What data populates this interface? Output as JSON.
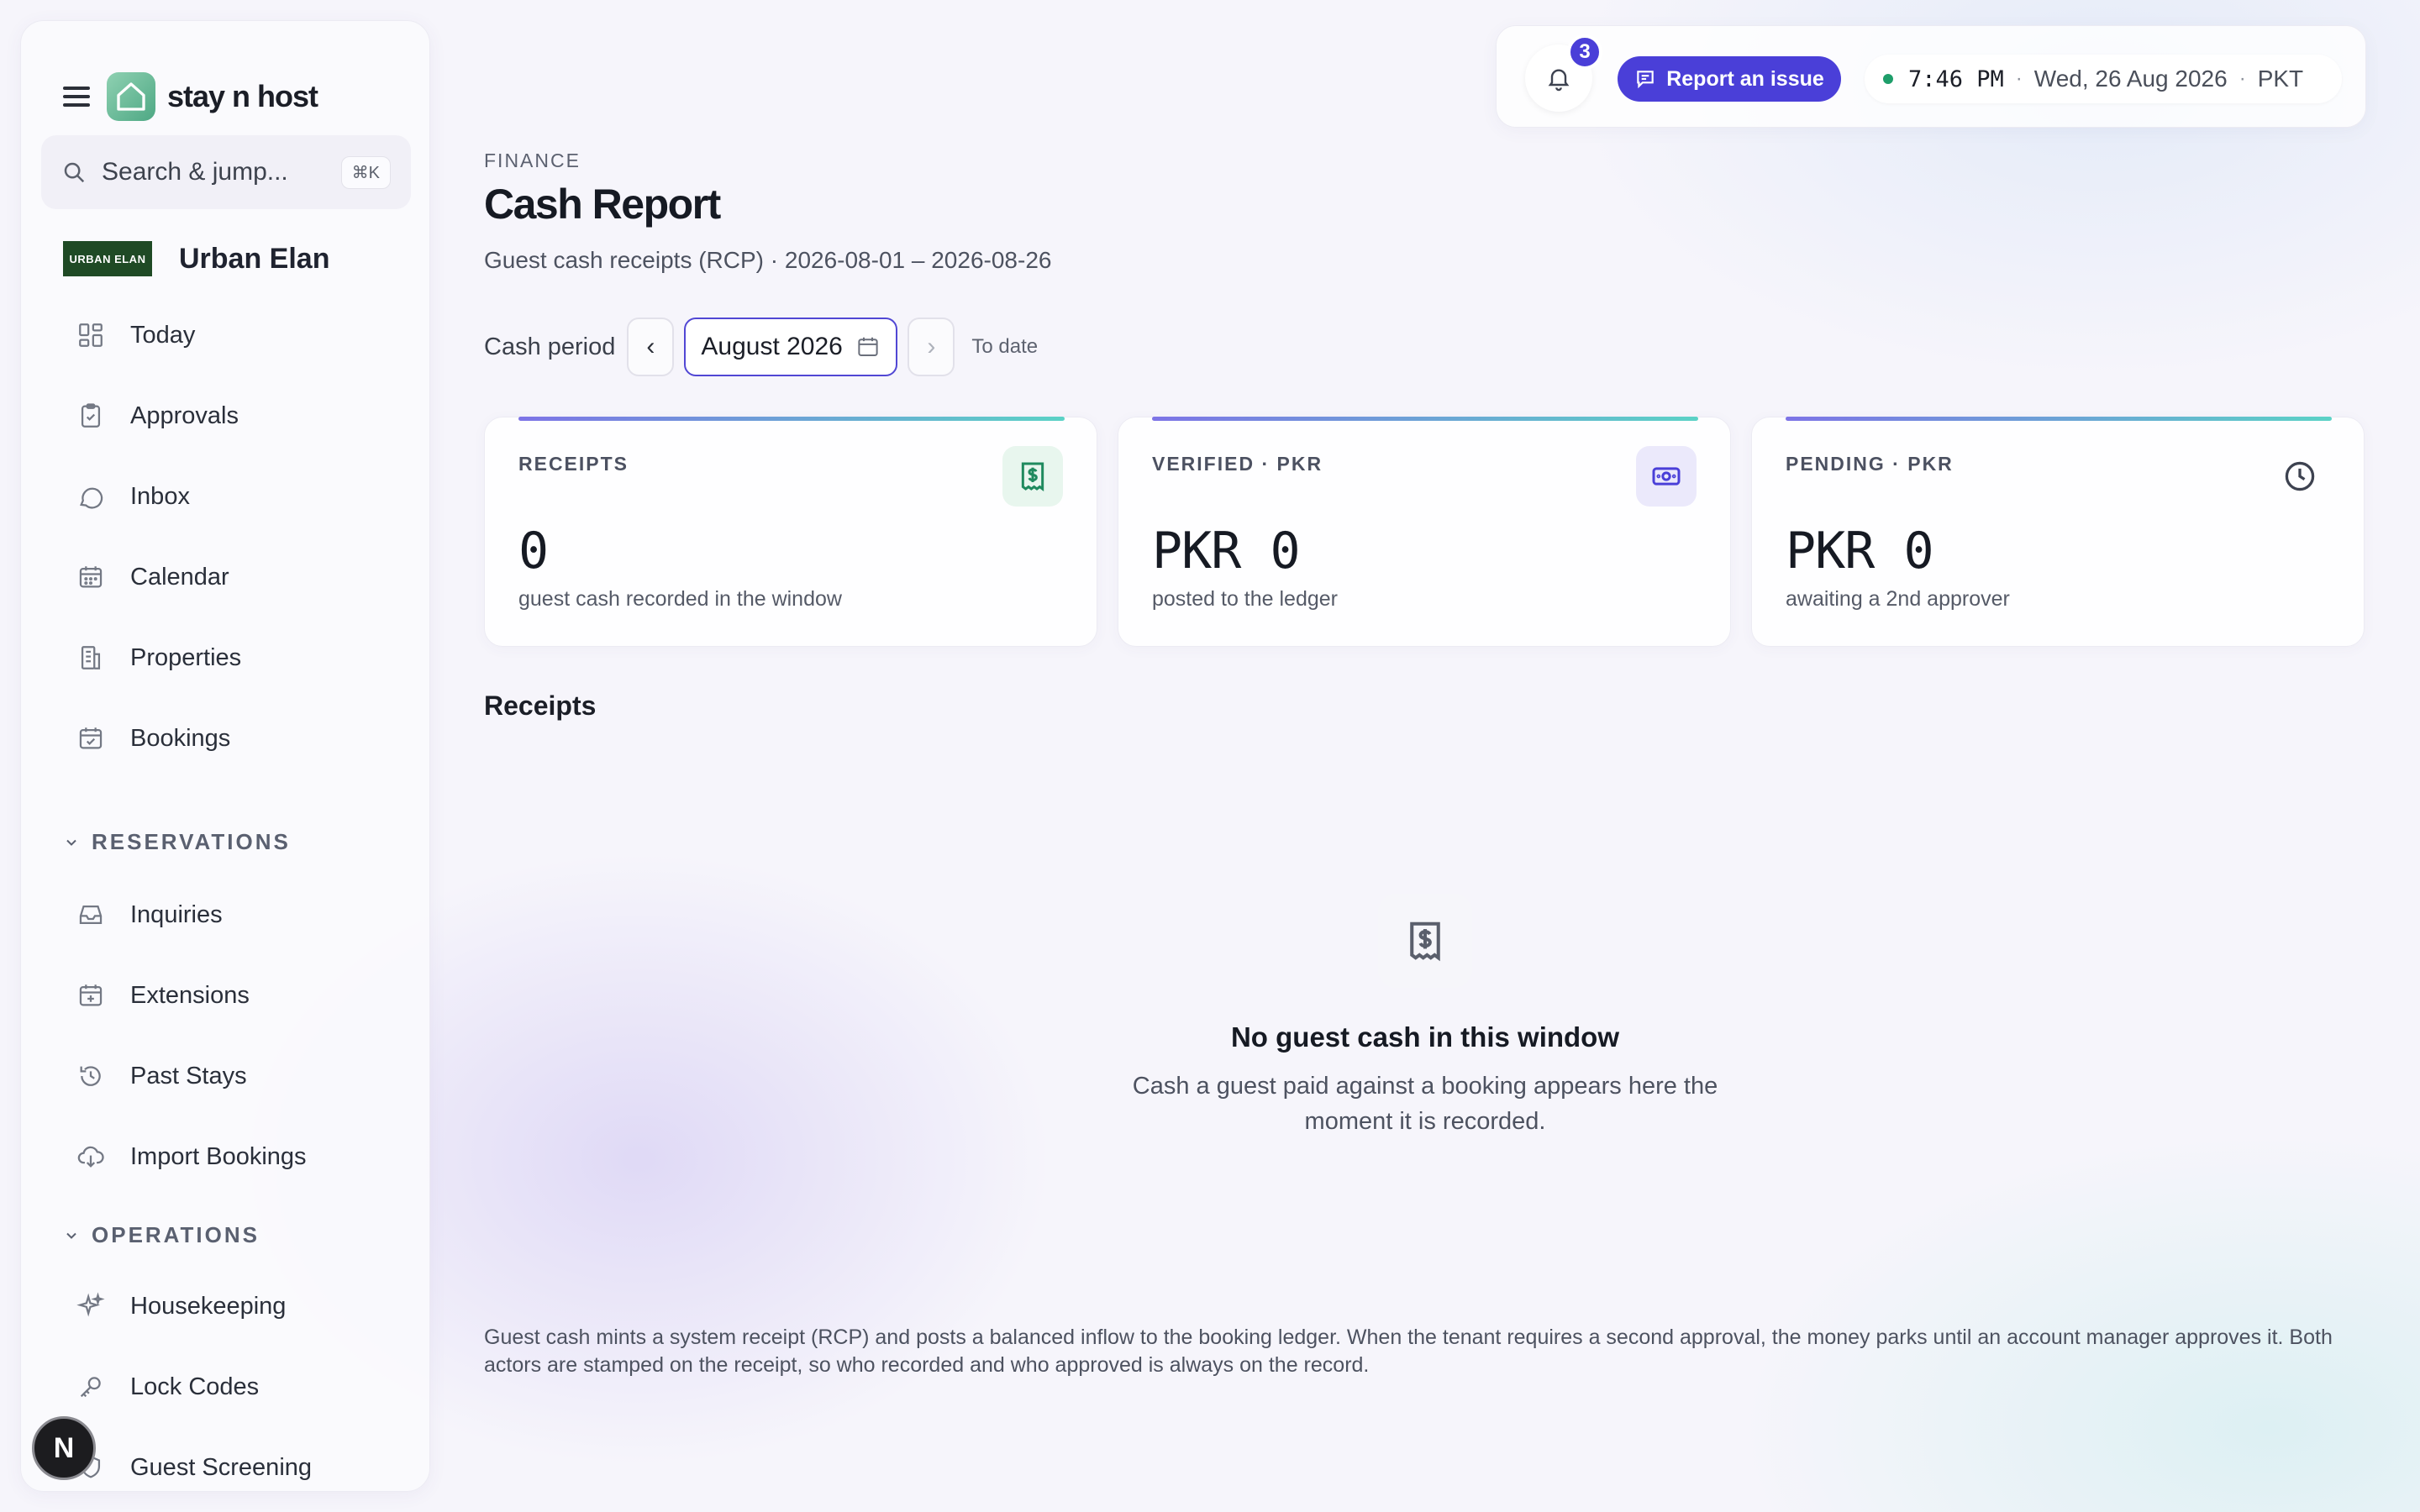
{
  "brand": {
    "name": "stay n host"
  },
  "search": {
    "placeholder": "Search & jump...",
    "shortcut": "⌘K"
  },
  "tenant": {
    "logo_text": "URBAN ELAN",
    "name": "Urban Elan"
  },
  "sidebar": {
    "items": [
      {
        "label": "Today",
        "icon": "dashboard-icon"
      },
      {
        "label": "Approvals",
        "icon": "clipboard-check-icon"
      },
      {
        "label": "Inbox",
        "icon": "chat-bubble-icon"
      },
      {
        "label": "Calendar",
        "icon": "calendar-icon"
      },
      {
        "label": "Properties",
        "icon": "building-icon"
      },
      {
        "label": "Bookings",
        "icon": "calendar-check-icon"
      }
    ],
    "sections": [
      {
        "label": "RESERVATIONS",
        "items": [
          {
            "label": "Inquiries",
            "icon": "inbox-tray-icon"
          },
          {
            "label": "Extensions",
            "icon": "calendar-plus-icon"
          },
          {
            "label": "Past Stays",
            "icon": "history-icon"
          },
          {
            "label": "Import Bookings",
            "icon": "cloud-download-icon"
          }
        ]
      },
      {
        "label": "OPERATIONS",
        "items": [
          {
            "label": "Housekeeping",
            "icon": "sparkles-icon"
          },
          {
            "label": "Lock Codes",
            "icon": "key-icon"
          },
          {
            "label": "Guest Screening",
            "icon": "shield-icon"
          }
        ]
      }
    ]
  },
  "avatar": {
    "initial": "N"
  },
  "topbar": {
    "notifications_count": "3",
    "report_label": "Report an issue",
    "time": "7:46 PM",
    "date": "Wed, 26 Aug 2026",
    "timezone": "PKT",
    "separator": "·"
  },
  "page": {
    "eyebrow": "FINANCE",
    "title": "Cash Report",
    "subtitle": "Guest cash receipts (RCP) · 2026-08-01 – 2026-08-26"
  },
  "period": {
    "label": "Cash period",
    "prev": "‹",
    "next": "›",
    "value": "August 2026",
    "to_date": "To date"
  },
  "cards": [
    {
      "label": "RECEIPTS",
      "value": "0",
      "desc": "guest cash recorded in the window",
      "icon": "receipt-dollar-icon",
      "accent": "#1f8a5e"
    },
    {
      "label": "VERIFIED · PKR",
      "value": "PKR 0",
      "desc": "posted to the ledger",
      "icon": "banknote-icon",
      "accent": "#4a3fd8"
    },
    {
      "label": "PENDING · PKR",
      "value": "PKR 0",
      "desc": "awaiting a 2nd approver",
      "icon": "clock-icon",
      "accent": "#3d4250"
    }
  ],
  "receipts": {
    "heading": "Receipts",
    "empty_title": "No guest cash in this window",
    "empty_desc": "Cash a guest paid against a booking appears here the moment it is recorded."
  },
  "footnote": "Guest cash mints a system receipt (RCP) and posts a balanced inflow to the booking ledger. When the tenant requires a second approval, the money parks until an account manager approves it. Both actors are stamped on the receipt, so who recorded and who approved is always on the record.",
  "colors": {
    "accent": "#4a3fd8",
    "brand_green": "#4ea884",
    "live_dot": "#1e9e6a"
  }
}
